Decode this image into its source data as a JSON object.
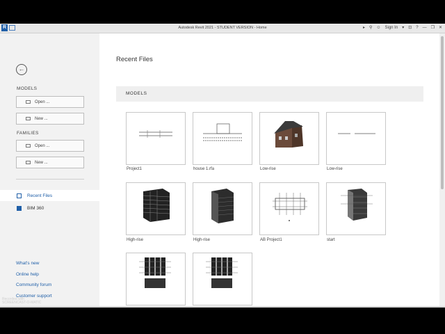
{
  "window": {
    "title": "Autodesk Revit 2021 - STUDENT VERSION - Home",
    "logo_letter": "R",
    "sign_in": "Sign In"
  },
  "sidebar": {
    "models_label": "MODELS",
    "models_open": "Open ...",
    "models_new": "New ...",
    "families_label": "FAMILIES",
    "families_open": "Open ...",
    "families_new": "New ...",
    "nav": [
      {
        "label": "Recent Files",
        "active": true
      },
      {
        "label": "BIM 360",
        "active": false
      }
    ],
    "links": [
      "What's new",
      "Online help",
      "Community forum",
      "Customer support"
    ]
  },
  "main": {
    "heading": "Recent Files",
    "section": "MODELS",
    "files": [
      {
        "name": "Project1",
        "thumb": "plan-icon"
      },
      {
        "name": "house 1.rfa",
        "thumb": "elevation-icon"
      },
      {
        "name": "Low-rise",
        "thumb": "house-3d-icon"
      },
      {
        "name": "Low-rise",
        "thumb": "line-drawing-icon"
      },
      {
        "name": "High-rise",
        "thumb": "frame-building-icon"
      },
      {
        "name": "High-rise",
        "thumb": "solid-building-icon"
      },
      {
        "name": "AB Project1",
        "thumb": "grid-plan-icon"
      },
      {
        "name": "start",
        "thumb": "construction-building-icon"
      },
      {
        "name": "",
        "thumb": "section-icon"
      },
      {
        "name": "",
        "thumb": "section-icon"
      }
    ]
  },
  "watermark": [
    "Recorded with",
    "SCREENCAST-O-MATIC"
  ]
}
